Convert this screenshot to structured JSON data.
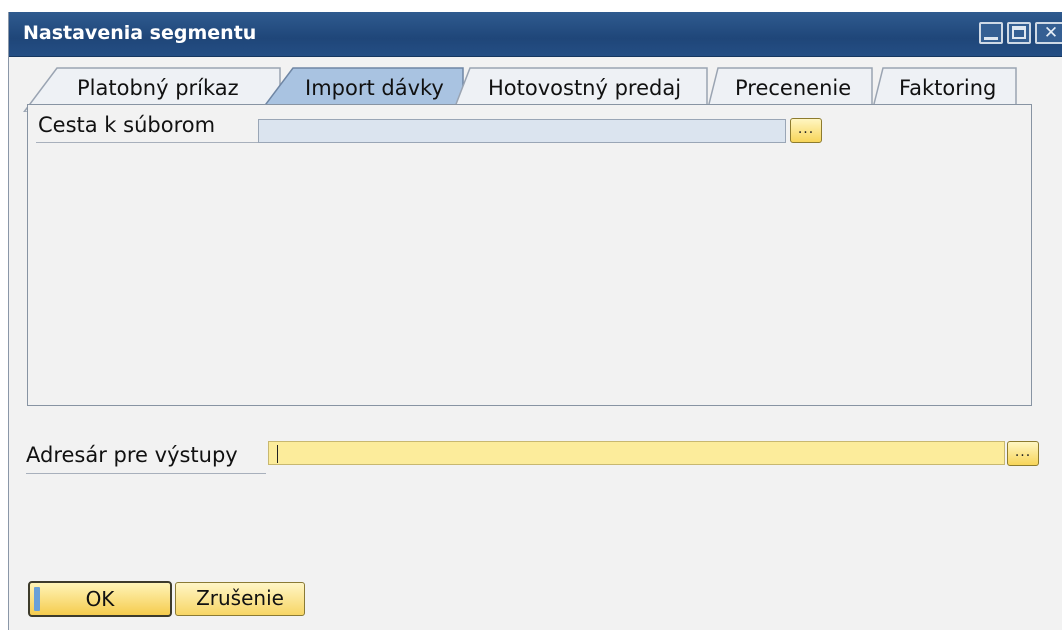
{
  "window": {
    "title": "Nastavenia segmentu"
  },
  "tabs": [
    {
      "label": "Platobný príkaz",
      "active": false
    },
    {
      "label": "Import dávky",
      "active": true
    },
    {
      "label": "Hotovostný predaj",
      "active": false
    },
    {
      "label": "Precenenie",
      "active": false
    },
    {
      "label": "Faktoring",
      "active": false
    }
  ],
  "import_tab": {
    "path_label": "Cesta k súborom",
    "path_value": "",
    "browse_label": "..."
  },
  "output": {
    "label": "Adresár pre výstupy",
    "value": "",
    "browse_label": "..."
  },
  "buttons": {
    "ok": "OK",
    "cancel": "Zrušenie"
  },
  "colors": {
    "titlebar": "#1f4679",
    "active_tab": "#a9c3e1",
    "inactive_tab": "#eef1f5",
    "path_field": "#dbe4ef",
    "output_field": "#fcec9b",
    "button_fill": "#f5cc4e"
  }
}
